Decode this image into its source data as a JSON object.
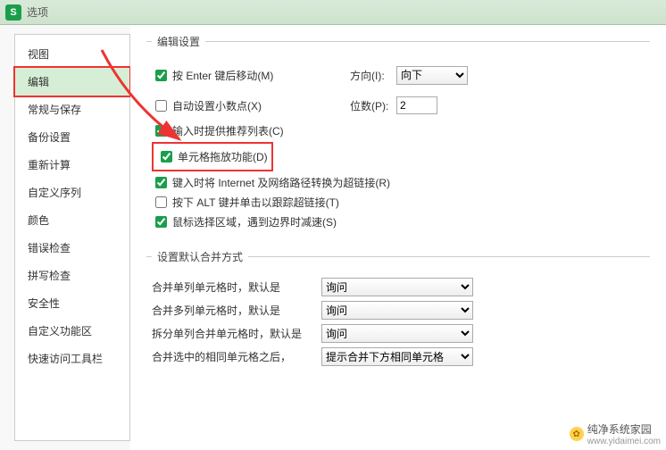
{
  "titlebar": {
    "app_icon_letter": "S",
    "title": "选项"
  },
  "sidebar": {
    "items": [
      "视图",
      "编辑",
      "常规与保存",
      "备份设置",
      "重新计算",
      "自定义序列",
      "颜色",
      "错误检查",
      "拼写检查",
      "安全性",
      "自定义功能区",
      "快速访问工具栏"
    ],
    "active_index": 1
  },
  "edit_group": {
    "legend": "编辑设置",
    "chk_enter": {
      "label": "按 Enter 键后移动(M)",
      "checked": true
    },
    "direction_label": "方向(I):",
    "direction_value": "向下",
    "chk_auto_decimal": {
      "label": "自动设置小数点(X)",
      "checked": false
    },
    "decimal_places_label": "位数(P):",
    "decimal_places_value": "2",
    "chk_recommend": {
      "label": "输入时提供推荐列表(C)",
      "checked": true
    },
    "chk_drag": {
      "label": "单元格拖放功能(D)",
      "checked": true
    },
    "chk_internet": {
      "label": "键入时将 Internet 及网络路径转换为超链接(R)",
      "checked": true
    },
    "chk_alt": {
      "label": "按下 ALT 键并单击以跟踪超链接(T)",
      "checked": false
    },
    "chk_mouse": {
      "label": "鼠标选择区域，遇到边界时减速(S)",
      "checked": true
    }
  },
  "merge_group": {
    "legend": "设置默认合并方式",
    "rows": [
      {
        "label": "合并单列单元格时，默认是",
        "value": "询问"
      },
      {
        "label": "合并多列单元格时，默认是",
        "value": "询问"
      },
      {
        "label": "拆分单列合并单元格时，默认是",
        "value": "询问"
      },
      {
        "label": "合并选中的相同单元格之后，",
        "value": "提示合并下方相同单元格"
      }
    ]
  },
  "watermark": {
    "text": "纯净系统家园",
    "url": "www.yidaimei.com"
  }
}
